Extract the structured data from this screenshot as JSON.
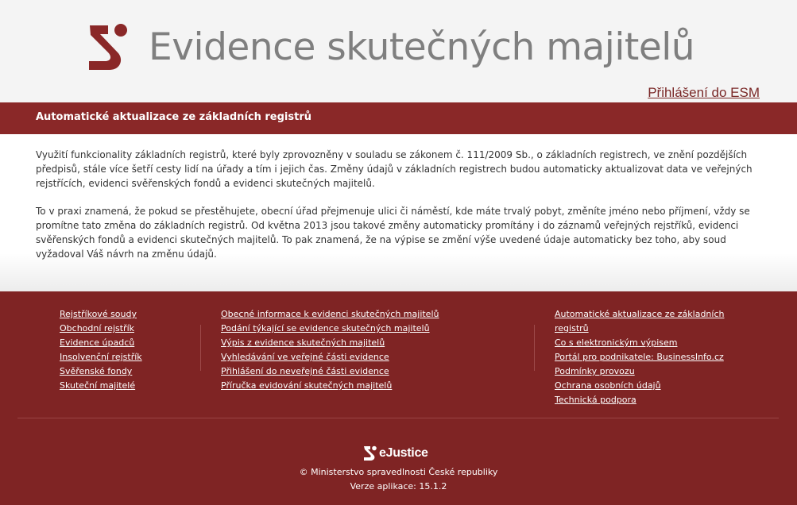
{
  "header": {
    "logo_icon": "esm-logo-icon",
    "title": "Evidence skutečných majitelů",
    "login_link": "Přihlášení do ESM"
  },
  "colors": {
    "brand_red": "#8a2828",
    "footer_red": "#7f2424",
    "title_gray": "#7f7f7f"
  },
  "main": {
    "heading": "Automatické aktualizace ze základních registrů",
    "paragraphs": [
      "Využití funkcionality základních registrů, které byly zprovozněny v souladu se zákonem č. 111/2009 Sb., o základních registrech, ve znění pozdějších předpisů, stále více šetří cesty lidí na úřady a tím i jejich čas. Změny údajů v základních registrech budou automaticky aktualizovat data ve veřejných rejstřících, evidenci svěřenských fondů a evidenci skutečných majitelů.",
      "To v praxi znamená, že pokud se přestěhujete, obecní úřad přejmenuje ulici či náměstí, kde máte trvalý pobyt, změníte jméno nebo příjmení, vždy se promítne tato změna do základních registrů. Od května 2013 jsou takové změny automaticky promítány i do záznamů veřejných rejstříků, evidenci svěřenských fondů a evidenci skutečných majitelů. To pak znamená, že na výpise se změní výše uvedené údaje automaticky bez toho, aby soud vyžadoval Váš návrh na změnu údajů."
    ]
  },
  "footer": {
    "col1": [
      "Rejstříkové soudy",
      "Obchodní rejstřík",
      "Evidence úpadců",
      "Insolvenční rejstřík",
      "Svěřenské fondy",
      "Skuteční majitelé"
    ],
    "col2": [
      "Obecné informace k evidenci skutečných majitelů",
      "Podání týkající se evidence skutečných majitelů",
      "Výpis z evidence skutečných majitelů",
      "Vyhledávání ve veřejné části evidence",
      "Přihlášení do neveřejné části evidence",
      "Příručka evidování skutečných majitelů"
    ],
    "col3": [
      "Automatické aktualizace ze základních registrů",
      "Co s elektronickým výpisem",
      "Portál pro podnikatele: BusinessInfo.cz",
      "Podmínky provozu",
      "Ochrana osobních údajů",
      "Technická podpora"
    ],
    "ejustice_logo_icon": "ejustice-logo-icon",
    "ejustice_text": "eJustice",
    "copyright": "© Ministerstvo spravedlnosti České republiky",
    "version": "Verze aplikace: 15.1.2"
  }
}
